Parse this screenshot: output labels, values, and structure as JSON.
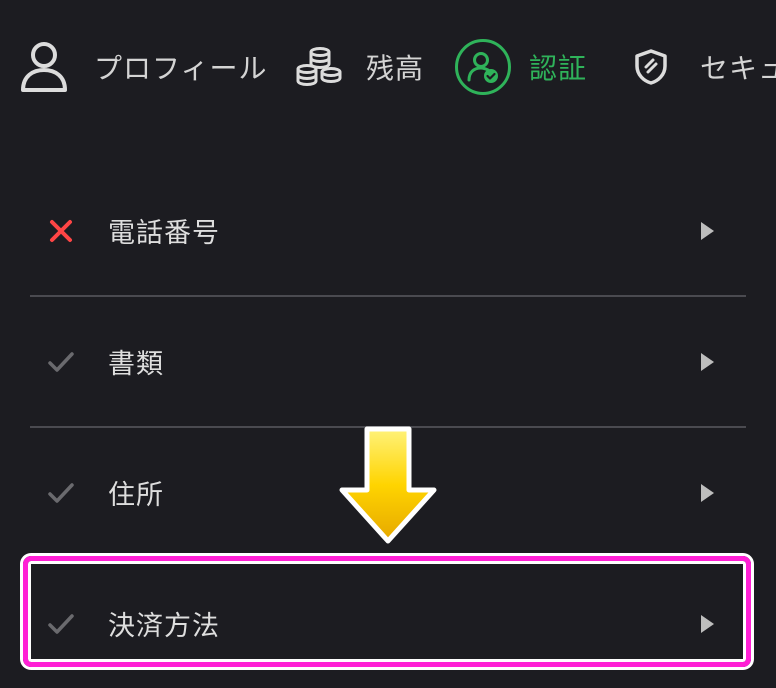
{
  "tabs": [
    {
      "label": "プロフィール",
      "icon": "user-icon",
      "active": false
    },
    {
      "label": "残高",
      "icon": "coins-icon",
      "active": false
    },
    {
      "label": "認証",
      "icon": "verified-user-icon",
      "active": true
    },
    {
      "label": "セキュ",
      "icon": "shield-icon",
      "active": false
    }
  ],
  "verification_items": [
    {
      "label": "電話番号",
      "status": "failed",
      "status_icon": "x-icon"
    },
    {
      "label": "書類",
      "status": "done",
      "status_icon": "check-icon"
    },
    {
      "label": "住所",
      "status": "done",
      "status_icon": "check-icon"
    },
    {
      "label": "決済方法",
      "status": "done",
      "status_icon": "check-icon"
    }
  ],
  "annotation": {
    "highlight_color": "#ff1fd5",
    "arrow_color": "#ffd400",
    "highlighted_item": "決済方法"
  },
  "colors": {
    "background": "#1c1c21",
    "accent": "#2fb35a",
    "error": "#ff4545",
    "check": "#6a6a6e"
  }
}
